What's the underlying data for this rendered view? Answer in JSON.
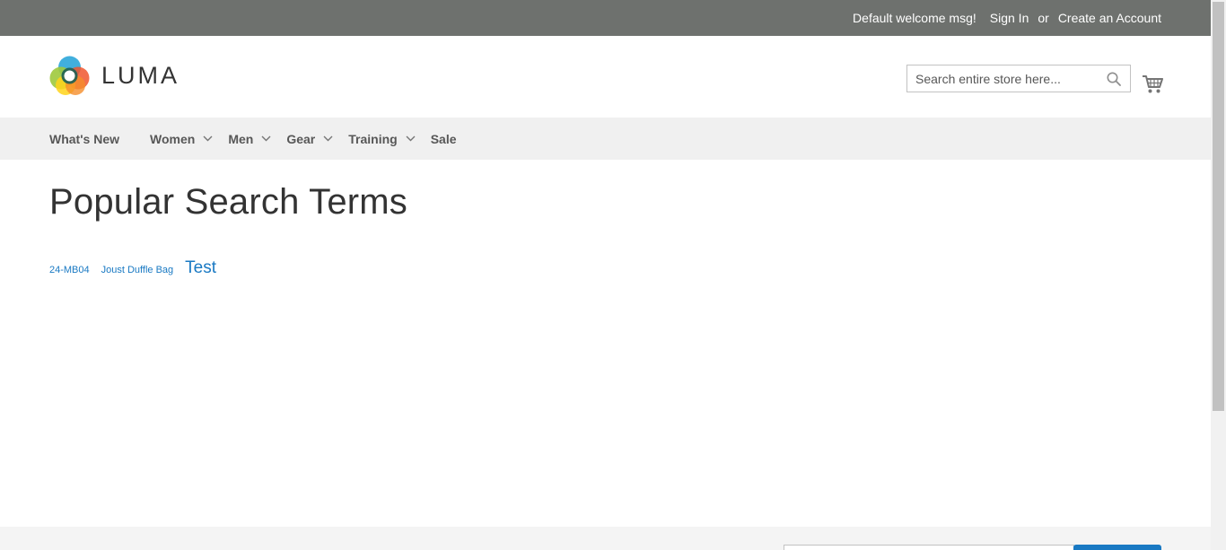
{
  "top_panel": {
    "welcome": "Default welcome msg!",
    "sign_in": "Sign In",
    "or": "or",
    "create_account": "Create an Account"
  },
  "header": {
    "logo_text": "LUMA",
    "search": {
      "placeholder": "Search entire store here...",
      "value": ""
    },
    "cart_icon": "shopping-cart-icon",
    "search_icon": "search-icon"
  },
  "nav": {
    "items": [
      {
        "label": "What's New",
        "has_dropdown": false
      },
      {
        "label": "Women",
        "has_dropdown": true
      },
      {
        "label": "Men",
        "has_dropdown": true
      },
      {
        "label": "Gear",
        "has_dropdown": true
      },
      {
        "label": "Training",
        "has_dropdown": true
      },
      {
        "label": "Sale",
        "has_dropdown": false
      }
    ]
  },
  "main": {
    "title": "Popular Search Terms",
    "terms": [
      {
        "label": "24-MB04"
      },
      {
        "label": "Joust Duffle Bag"
      },
      {
        "label": "Test"
      }
    ]
  },
  "colors": {
    "top_panel_bg": "#6e716e",
    "nav_bg": "#f0f0f0",
    "link_blue": "#1979c3"
  }
}
